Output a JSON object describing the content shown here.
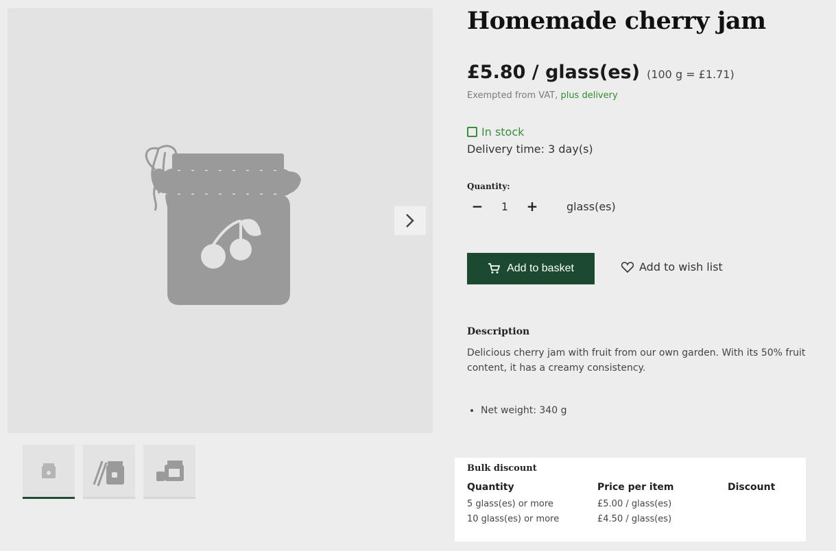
{
  "product": {
    "title": "Homemade cherry jam",
    "price": "£5.80 / glass(es)",
    "unit_price": "(100 g = £1.71)",
    "vat_text": "Exempted from VAT,",
    "delivery_link": "plus delivery",
    "stock": "In stock",
    "delivery_time": "Delivery time: 3 day(s)"
  },
  "quantity": {
    "label": "Quantity:",
    "value": "1",
    "unit": "glass(es)"
  },
  "actions": {
    "add_to_basket": "Add to basket",
    "add_to_wish_list": "Add to wish list"
  },
  "description": {
    "heading": "Description",
    "text": "Delicious cherry jam with fruit from our own garden. With its 50% fruit content, it has a creamy consistency.",
    "bullets": [
      "Net weight: 340 g"
    ]
  },
  "bulk_discount": {
    "title": "Bulk discount",
    "headers": [
      "Quantity",
      "Price per item",
      "Discount"
    ],
    "rows": [
      [
        "5 glass(es) or more",
        "£5.00 / glass(es)",
        ""
      ],
      [
        "10 glass(es) or more",
        "£4.50 / glass(es)",
        ""
      ]
    ]
  },
  "gallery": {
    "thumbnail_count": 3,
    "active_thumbnail": 1
  },
  "colors": {
    "primary_button": "#1b4a30",
    "stock_green": "#3c8c3c",
    "link_green": "#2e8b2e",
    "placeholder_gray": "#9a9a9a"
  }
}
